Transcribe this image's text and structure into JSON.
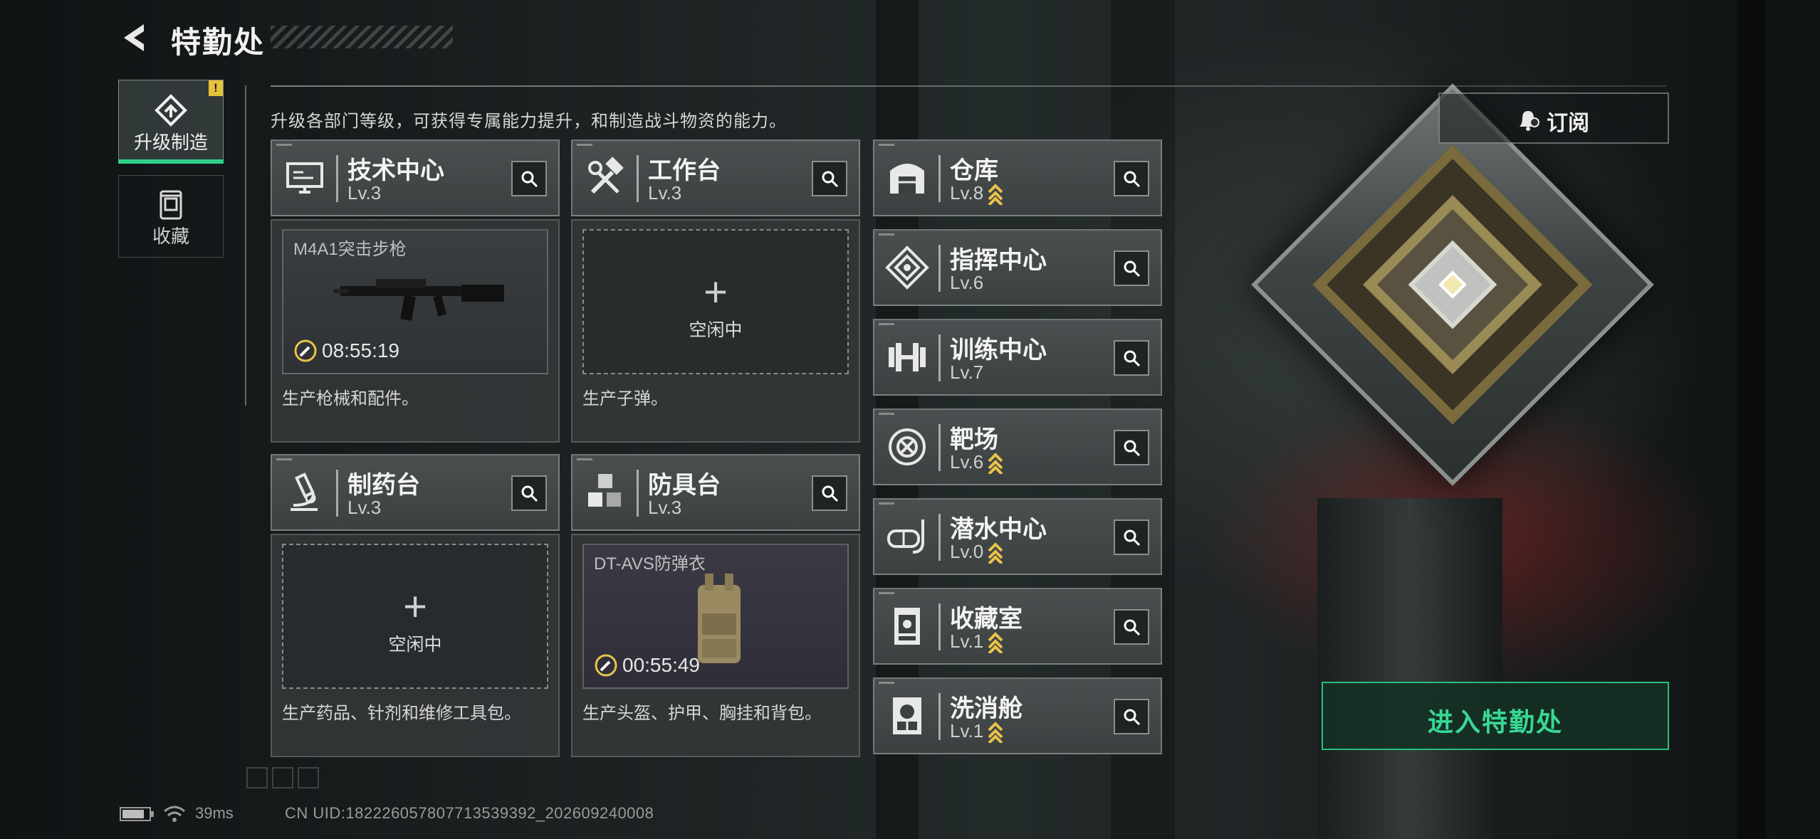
{
  "header": {
    "title": "特勤处"
  },
  "nav": {
    "upgrade_label": "升级制造",
    "upgrade_alert": "!",
    "collect_label": "收藏"
  },
  "intro": "升级各部门等级，可获得专属能力提升，和制造战斗物资的能力。",
  "departments": {
    "tech": {
      "name": "技术中心",
      "level": "Lv.3",
      "icon": "monitor-icon"
    },
    "workbench": {
      "name": "工作台",
      "level": "Lv.3",
      "icon": "hammer-wrench-icon"
    },
    "pharmacy": {
      "name": "制药台",
      "level": "Lv.3",
      "icon": "microscope-icon"
    },
    "armory": {
      "name": "防具台",
      "level": "Lv.3",
      "icon": "cubes-icon"
    },
    "warehouse": {
      "name": "仓库",
      "level": "Lv.8",
      "icon": "garage-icon",
      "upgradable": true
    },
    "command": {
      "name": "指挥中心",
      "level": "Lv.6",
      "icon": "command-emblem-icon",
      "upgradable": false
    },
    "training": {
      "name": "训练中心",
      "level": "Lv.7",
      "icon": "dumbbell-icon",
      "upgradable": false
    },
    "range": {
      "name": "靶场",
      "level": "Lv.6",
      "icon": "target-icon",
      "upgradable": true
    },
    "diving": {
      "name": "潜水中心",
      "level": "Lv.0",
      "icon": "diving-mask-icon",
      "upgradable": true
    },
    "collection": {
      "name": "收藏室",
      "level": "Lv.1",
      "icon": "display-case-icon",
      "upgradable": true
    },
    "decon": {
      "name": "洗消舱",
      "level": "Lv.1",
      "icon": "hazmat-icon",
      "upgradable": true
    }
  },
  "production": {
    "tech": {
      "item": "M4A1突击步枪",
      "timer": "08:55:19",
      "desc": "生产枪械和配件。"
    },
    "workbench": {
      "idle_label": "空闲中",
      "desc": "生产子弹。"
    },
    "pharmacy": {
      "idle_label": "空闲中",
      "desc": "生产药品、针剂和维修工具包。"
    },
    "armory": {
      "item": "DT-AVS防弹衣",
      "timer": "00:55:49",
      "desc": "生产头盔、护甲、胸挂和背包。"
    }
  },
  "right": {
    "subscribe_label": "订阅",
    "enter_label": "进入特勤处"
  },
  "status": {
    "ping": "39ms",
    "uid": "CN UID:18222605780771353939​2_202609240008"
  },
  "colors": {
    "accent_green": "#2fd18a",
    "upgrade_gold": "#e8c24a",
    "alert_yellow": "#e6c23a"
  }
}
